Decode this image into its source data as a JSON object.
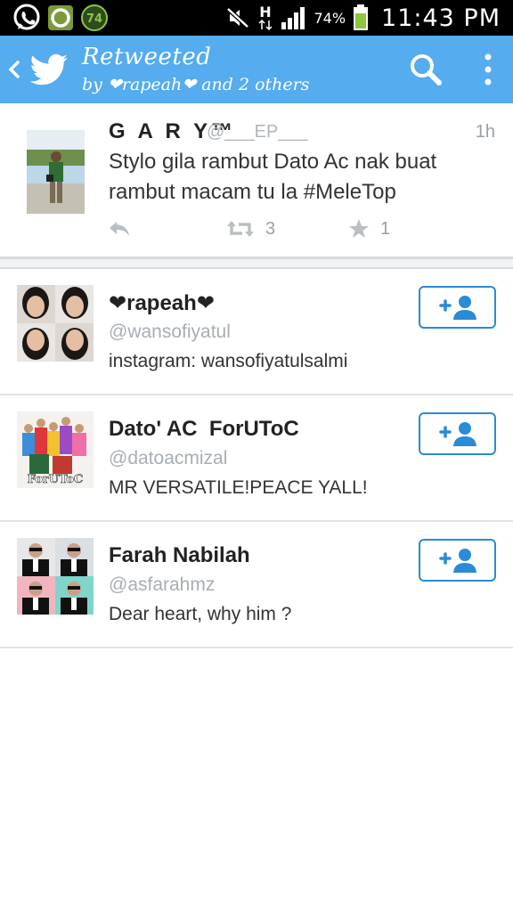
{
  "status_bar": {
    "battery_percent": "74%",
    "time": "11:43 PM",
    "notification_badge": "74",
    "network_type": "H",
    "icons": [
      "whatsapp-icon",
      "green-app-icon",
      "badge-counter-icon",
      "mute-icon",
      "network-h-icon",
      "signal-icon",
      "battery-icon"
    ]
  },
  "action_bar": {
    "title": "Retweeted",
    "subtitle": "by ❤rapeah❤ and 2 others",
    "color": "#55acee"
  },
  "tweet": {
    "name": "G A R Y™",
    "handle": "@___EP___",
    "time": "1h",
    "text": "Stylo gila rambut Dato Ac nak buat rambut macam tu la #MeleTop",
    "retweet_count": "3",
    "favorite_count": "1"
  },
  "users": [
    {
      "name": "❤rapeah❤",
      "handle": "@wansofiyatul",
      "bio": "instagram: wansofiyatulsalmi"
    },
    {
      "name": "Dato' AC  ForUToC",
      "handle": "@datoacmizal",
      "bio": "MR VERSATILE!PEACE YALL!"
    },
    {
      "name": "Farah Nabilah",
      "handle": "@asfarahmz",
      "bio": "Dear heart, why him ?"
    }
  ],
  "avatar_badge_text": "ForUToC",
  "colors": {
    "accent": "#55acee",
    "follow_border": "#2a8bd6",
    "muted_text": "#a7aeb4"
  }
}
